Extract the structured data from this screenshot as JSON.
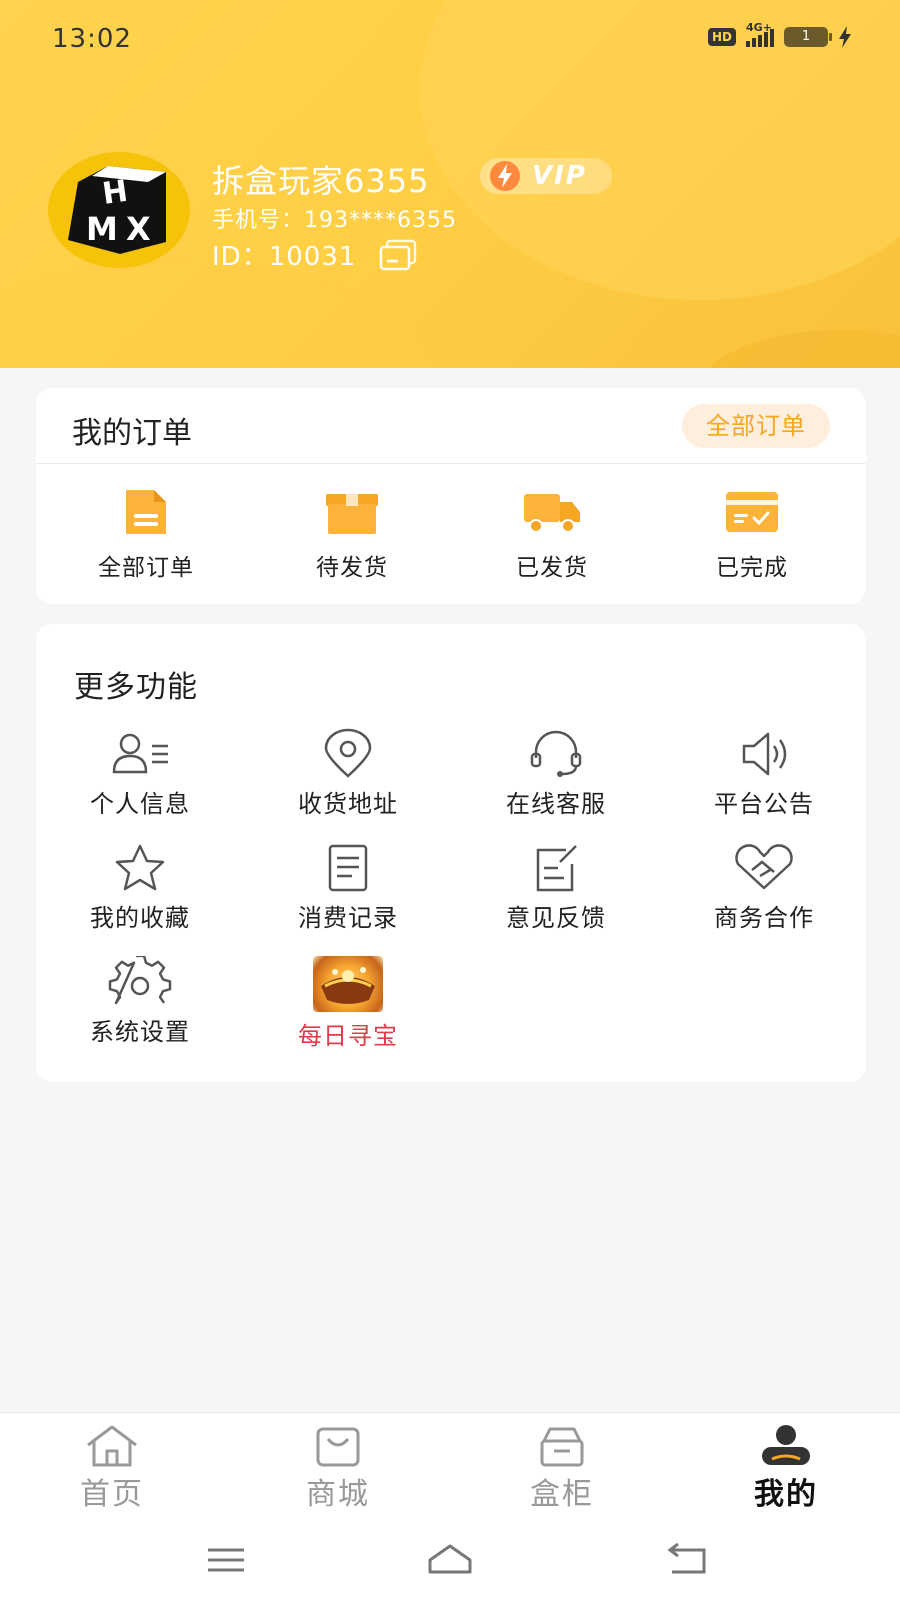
{
  "status_bar": {
    "time": "13:02",
    "hd": "HD",
    "network": "4G+",
    "battery": "1"
  },
  "profile": {
    "username": "拆盒玩家6355",
    "vip_label": "VIP",
    "phone": "手机号：193****6355",
    "id": "ID：10031",
    "avatar_logo": "HMX"
  },
  "orders": {
    "title": "我的订单",
    "all_button": "全部订单",
    "items": [
      {
        "label": "全部订单",
        "icon": "document-icon"
      },
      {
        "label": "待发货",
        "icon": "package-icon"
      },
      {
        "label": "已发货",
        "icon": "truck-icon"
      },
      {
        "label": "已完成",
        "icon": "card-check-icon"
      }
    ]
  },
  "more": {
    "title": "更多功能",
    "items": [
      {
        "label": "个人信息",
        "icon": "user-list-icon"
      },
      {
        "label": "收货地址",
        "icon": "location-pin-icon"
      },
      {
        "label": "在线客服",
        "icon": "headset-icon"
      },
      {
        "label": "平台公告",
        "icon": "speaker-icon"
      },
      {
        "label": "我的收藏",
        "icon": "star-icon"
      },
      {
        "label": "消费记录",
        "icon": "document-lines-icon"
      },
      {
        "label": "意见反馈",
        "icon": "edit-note-icon"
      },
      {
        "label": "商务合作",
        "icon": "handshake-heart-icon"
      },
      {
        "label": "系统设置",
        "icon": "gear-icon"
      },
      {
        "label": "每日寻宝",
        "icon": "treasure-image"
      }
    ]
  },
  "tabbar": {
    "items": [
      {
        "label": "首页",
        "icon": "home-icon"
      },
      {
        "label": "商城",
        "icon": "shopping-bag-icon"
      },
      {
        "label": "盒柜",
        "icon": "box-cabinet-icon"
      },
      {
        "label": "我的",
        "icon": "user-icon"
      }
    ],
    "active_index": 3
  },
  "colors": {
    "header_yellow": "#ffcf45",
    "accent_orange": "#f5a623",
    "treasure_red": "#e23b4a"
  }
}
